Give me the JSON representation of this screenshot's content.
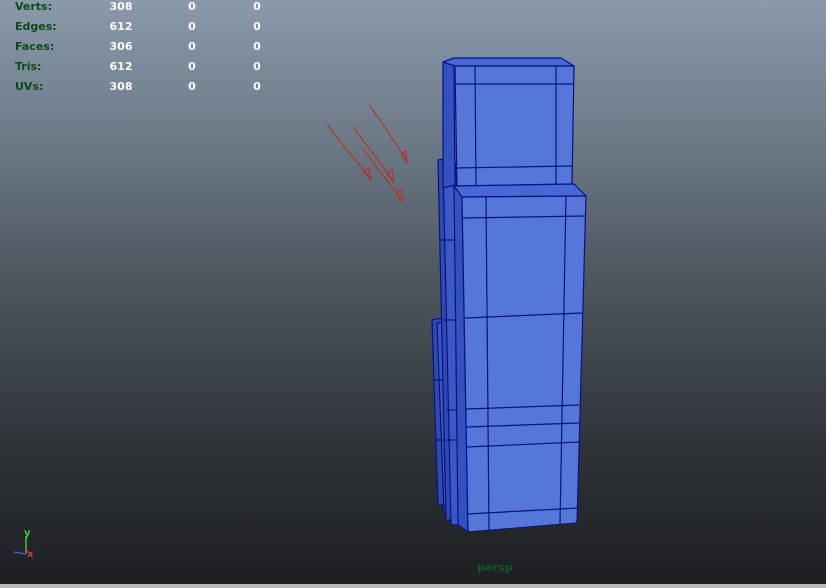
{
  "hud": {
    "rows": [
      {
        "label": "Verts:",
        "values": [
          "308",
          "0",
          "0"
        ]
      },
      {
        "label": "Edges:",
        "values": [
          "612",
          "0",
          "0"
        ]
      },
      {
        "label": "Faces:",
        "values": [
          "306",
          "0",
          "0"
        ]
      },
      {
        "label": "Tris:",
        "values": [
          "612",
          "0",
          "0"
        ]
      },
      {
        "label": "UVs:",
        "values": [
          "308",
          "0",
          "0"
        ]
      }
    ]
  },
  "viewport": {
    "camera": "persp",
    "axis": {
      "y": "y",
      "x": "x"
    }
  },
  "colors": {
    "mesh_fill": "#5577d9",
    "mesh_wire": "#0b1280",
    "light_arrow": "#c02a1a",
    "hud_label": "#0d4a1a",
    "hud_value": "#ffffff",
    "camera_label": "#0d5a22"
  },
  "scene": {
    "objects": [
      "polygon-mesh-building",
      "directional-light"
    ]
  }
}
